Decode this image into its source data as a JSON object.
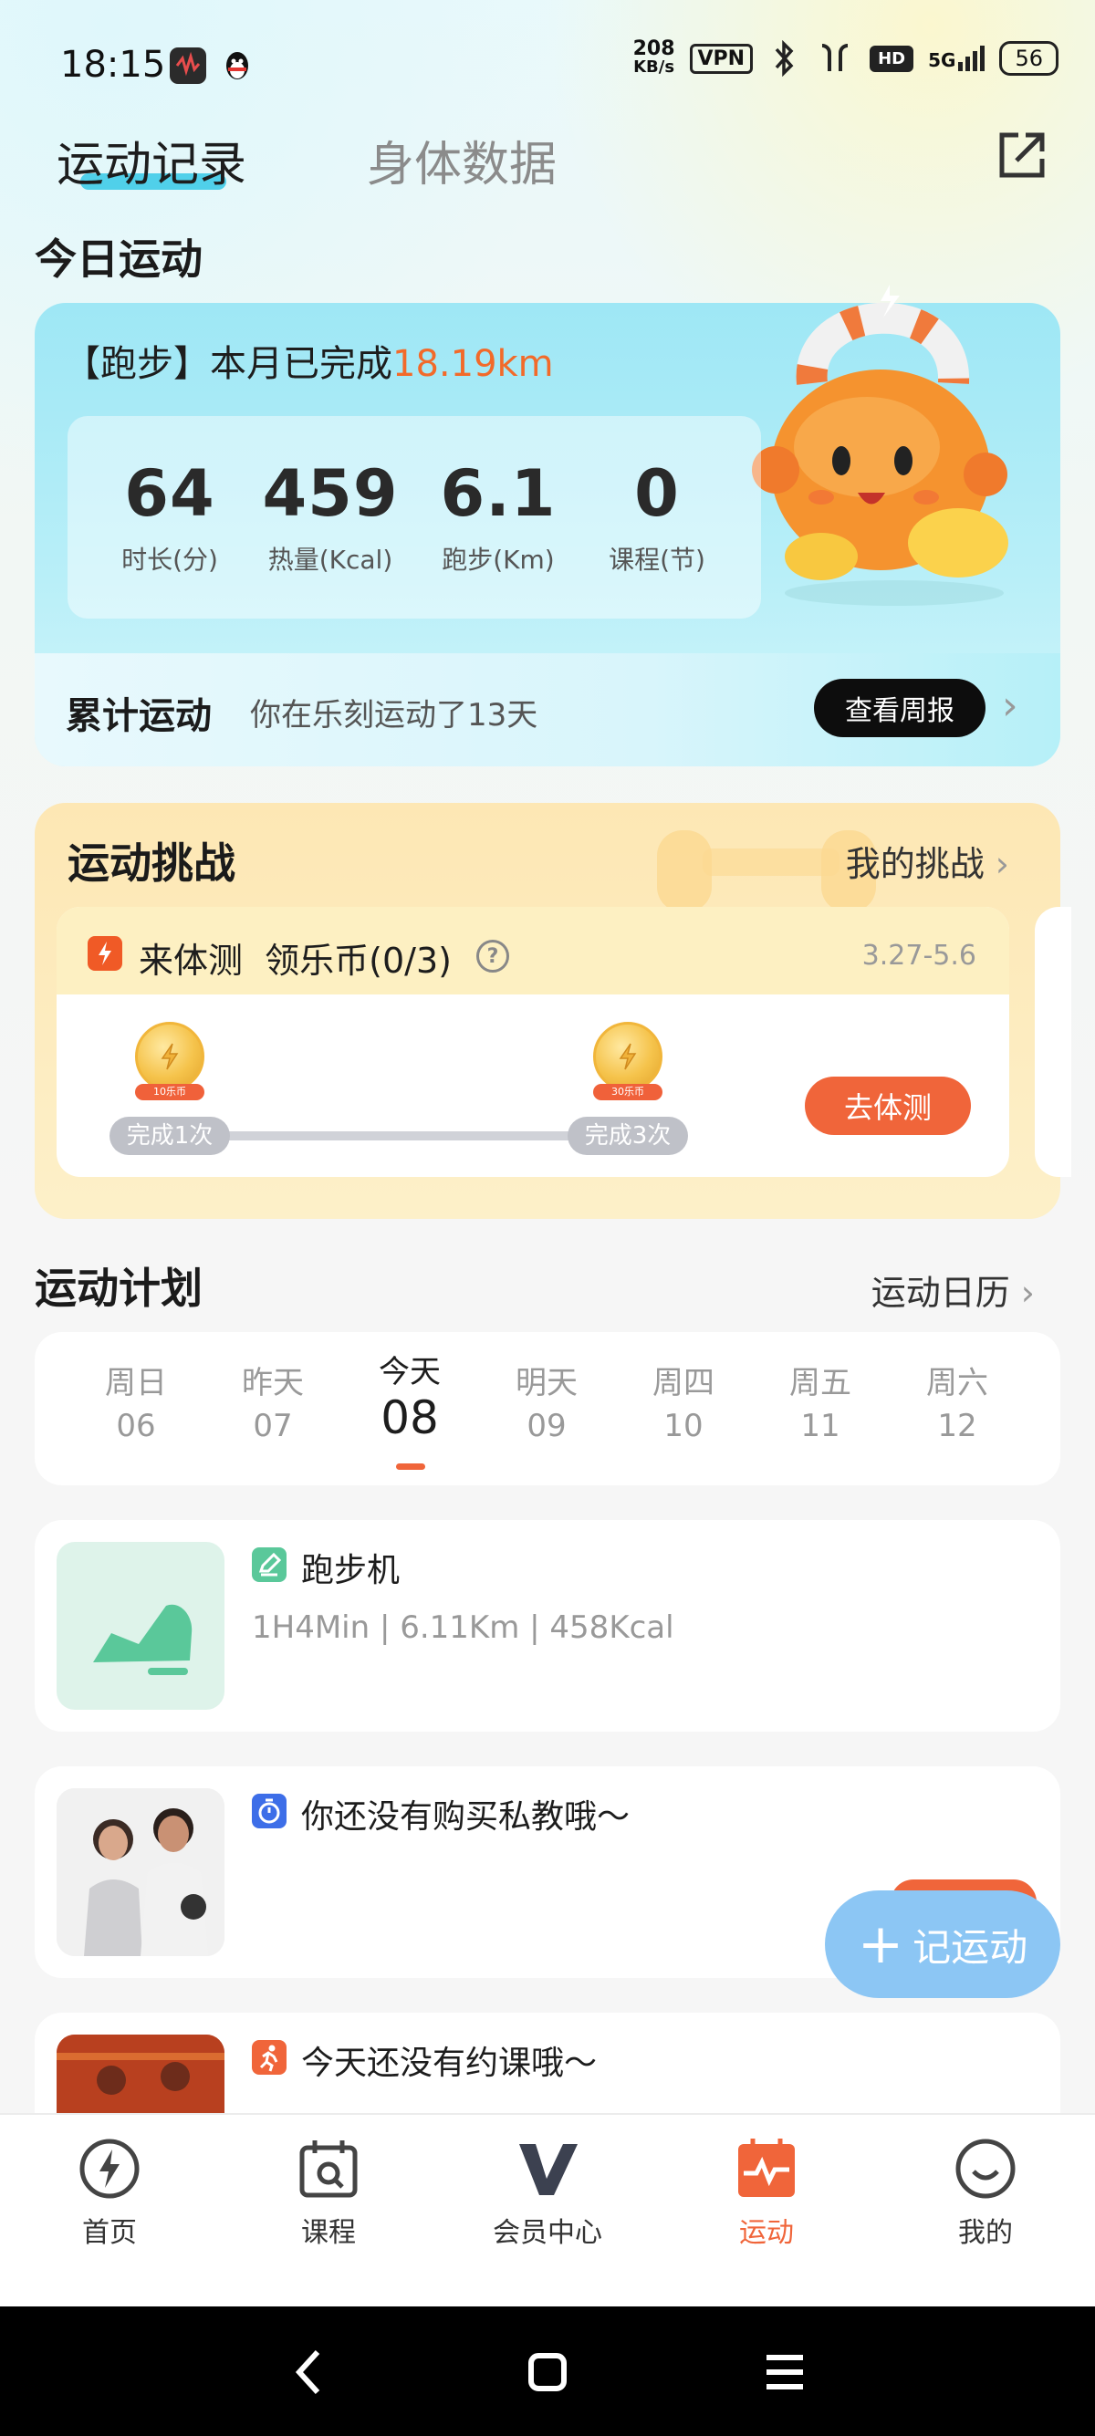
{
  "status_bar": {
    "time": "18:15",
    "net_speed_top": "208",
    "net_speed_bottom": "KB/s",
    "vpn": "VPN",
    "hd": "HD",
    "signal": "5G",
    "battery": "56"
  },
  "tabs": [
    {
      "label": "运动记录",
      "active": true
    },
    {
      "label": "身体数据",
      "active": false
    }
  ],
  "today": {
    "section_title": "今日运动",
    "headline_prefix": "【跑步】本月已完成",
    "headline_value": "18.19km",
    "stats": [
      {
        "value": "64",
        "label": "时长(分)"
      },
      {
        "value": "459",
        "label": "热量(Kcal)"
      },
      {
        "value": "6.1",
        "label": "跑步(Km)"
      },
      {
        "value": "0",
        "label": "课程(节)"
      }
    ],
    "cumulative_label": "累计运动",
    "cumulative_text": "你在乐刻运动了13天",
    "weekly_button": "查看周报"
  },
  "challenge": {
    "title": "运动挑战",
    "my_challenge": "我的挑战",
    "task_name": "来体测  领乐币(0/3)",
    "help": "?",
    "date_range": "3.27-5.6",
    "milestones": [
      {
        "label": "完成1次",
        "reward": "10乐币"
      },
      {
        "label": "完成3次",
        "reward": "30乐币"
      }
    ],
    "action_button": "去体测"
  },
  "plan": {
    "title": "运动计划",
    "calendar_link": "运动日历",
    "days": [
      {
        "name": "周日",
        "date": "06"
      },
      {
        "name": "昨天",
        "date": "07"
      },
      {
        "name": "今天",
        "date": "08"
      },
      {
        "name": "明天",
        "date": "09"
      },
      {
        "name": "周四",
        "date": "10"
      },
      {
        "name": "周五",
        "date": "11"
      },
      {
        "name": "周六",
        "date": "12"
      }
    ],
    "items": [
      {
        "title": "跑步机",
        "subtitle": "1H4Min | 6.11Km | 458Kcal"
      },
      {
        "title": "你还没有购买私教哦～"
      },
      {
        "title": "今天还没有约课哦～"
      }
    ]
  },
  "fab": {
    "label": "记运动"
  },
  "bottom_nav": [
    {
      "label": "首页",
      "icon": "home-bolt-icon"
    },
    {
      "label": "课程",
      "icon": "calendar-icon"
    },
    {
      "label": "会员中心",
      "icon": "vip-icon"
    },
    {
      "label": "运动",
      "icon": "sport-calendar-icon",
      "active": true
    },
    {
      "label": "我的",
      "icon": "profile-face-icon"
    }
  ],
  "colors": {
    "accent": "#f0653a",
    "tab_underline": "#36c9e6",
    "challenge_bg": "#fde7b4",
    "today_card_bg": "#9ee7f5"
  }
}
